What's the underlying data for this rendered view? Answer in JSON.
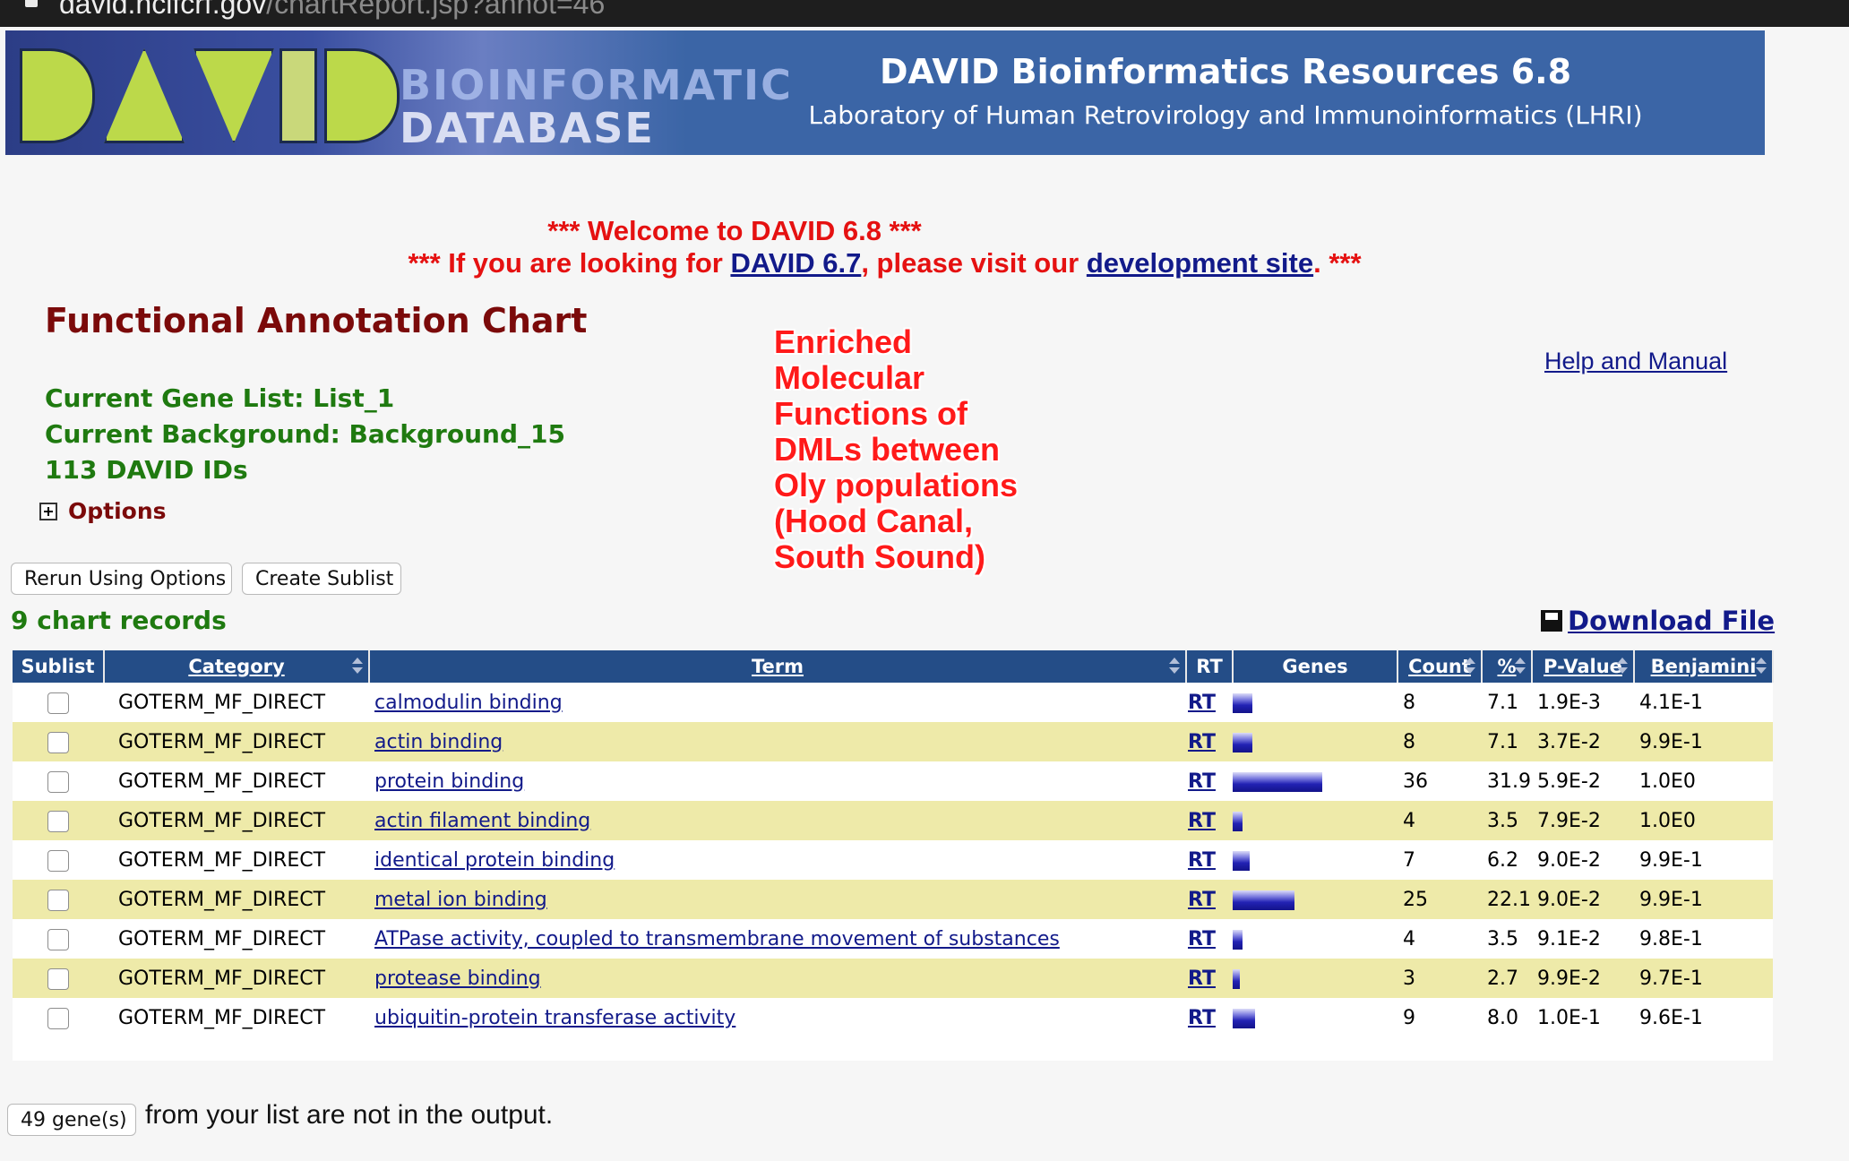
{
  "browser": {
    "url_host": "david.ncifcrf.gov",
    "url_path": "/chartReport.jsp?annot=46"
  },
  "banner": {
    "logo_text": "DAVID",
    "logo_line1": "BIOINFORMATIC",
    "logo_line2": "DATABASE",
    "title": "DAVID Bioinformatics Resources 6.8",
    "subtitle": "Laboratory of Human Retrovirology and Immunoinformatics (LHRI)"
  },
  "welcome": {
    "line1": "*** Welcome to DAVID 6.8 ***",
    "line2_prefix": "*** If you are looking for ",
    "line2_link1": "DAVID 6.7",
    "line2_mid": ", please visit our ",
    "line2_link2": "development site",
    "line2_suffix": ". ***"
  },
  "page_title": "Functional Annotation Chart",
  "info": {
    "gene_list": "Current Gene List: List_1",
    "background": "Current Background: Background_15",
    "ids": "113 DAVID IDs",
    "options": "Options"
  },
  "annotation_lines": [
    "Enriched",
    "Molecular",
    "Functions of",
    "DMLs between",
    "Oly populations",
    "(Hood Canal,",
    "South Sound)"
  ],
  "help_link": "Help and Manual",
  "buttons": {
    "rerun": "Rerun Using Options",
    "sublist": "Create Sublist"
  },
  "records_label": "9 chart records",
  "download_label": "Download File",
  "table": {
    "headers": {
      "sublist": "Sublist",
      "category": "Category",
      "term": "Term",
      "rt": "RT",
      "genes": "Genes",
      "count": "Count",
      "percent": "%",
      "pvalue": "P-Value",
      "benjamini": "Benjamini"
    },
    "rows": [
      {
        "category": "GOTERM_MF_DIRECT",
        "term": "calmodulin binding",
        "rt": "RT",
        "count": "8",
        "percent": "7.1",
        "pvalue": "1.9E-3",
        "benjamini": "4.1E-1"
      },
      {
        "category": "GOTERM_MF_DIRECT",
        "term": "actin binding",
        "rt": "RT",
        "count": "8",
        "percent": "7.1",
        "pvalue": "3.7E-2",
        "benjamini": "9.9E-1"
      },
      {
        "category": "GOTERM_MF_DIRECT",
        "term": "protein binding",
        "rt": "RT",
        "count": "36",
        "percent": "31.9",
        "pvalue": "5.9E-2",
        "benjamini": "1.0E0"
      },
      {
        "category": "GOTERM_MF_DIRECT",
        "term": "actin filament binding",
        "rt": "RT",
        "count": "4",
        "percent": "3.5",
        "pvalue": "7.9E-2",
        "benjamini": "1.0E0"
      },
      {
        "category": "GOTERM_MF_DIRECT",
        "term": "identical protein binding",
        "rt": "RT",
        "count": "7",
        "percent": "6.2",
        "pvalue": "9.0E-2",
        "benjamini": "9.9E-1"
      },
      {
        "category": "GOTERM_MF_DIRECT",
        "term": "metal ion binding",
        "rt": "RT",
        "count": "25",
        "percent": "22.1",
        "pvalue": "9.0E-2",
        "benjamini": "9.9E-1"
      },
      {
        "category": "GOTERM_MF_DIRECT",
        "term": "ATPase activity, coupled to transmembrane movement of substances",
        "rt": "RT",
        "count": "4",
        "percent": "3.5",
        "pvalue": "9.1E-2",
        "benjamini": "9.8E-1"
      },
      {
        "category": "GOTERM_MF_DIRECT",
        "term": "protease binding",
        "rt": "RT",
        "count": "3",
        "percent": "2.7",
        "pvalue": "9.9E-2",
        "benjamini": "9.7E-1"
      },
      {
        "category": "GOTERM_MF_DIRECT",
        "term": "ubiquitin-protein transferase activity",
        "rt": "RT",
        "count": "9",
        "percent": "8.0",
        "pvalue": "1.0E-1",
        "benjamini": "9.6E-1"
      }
    ]
  },
  "not_in_output": {
    "button": "49 gene(s)",
    "text": "from your list are not in the output."
  },
  "colors": {
    "header_blue": "#244d87",
    "banner_blue": "#3b65a6",
    "row_alt": "#eeeaa9",
    "link_blue": "#121a8a",
    "title_red": "#7b0a0a",
    "info_green": "#1f7a10",
    "alert_red": "#e51111"
  }
}
